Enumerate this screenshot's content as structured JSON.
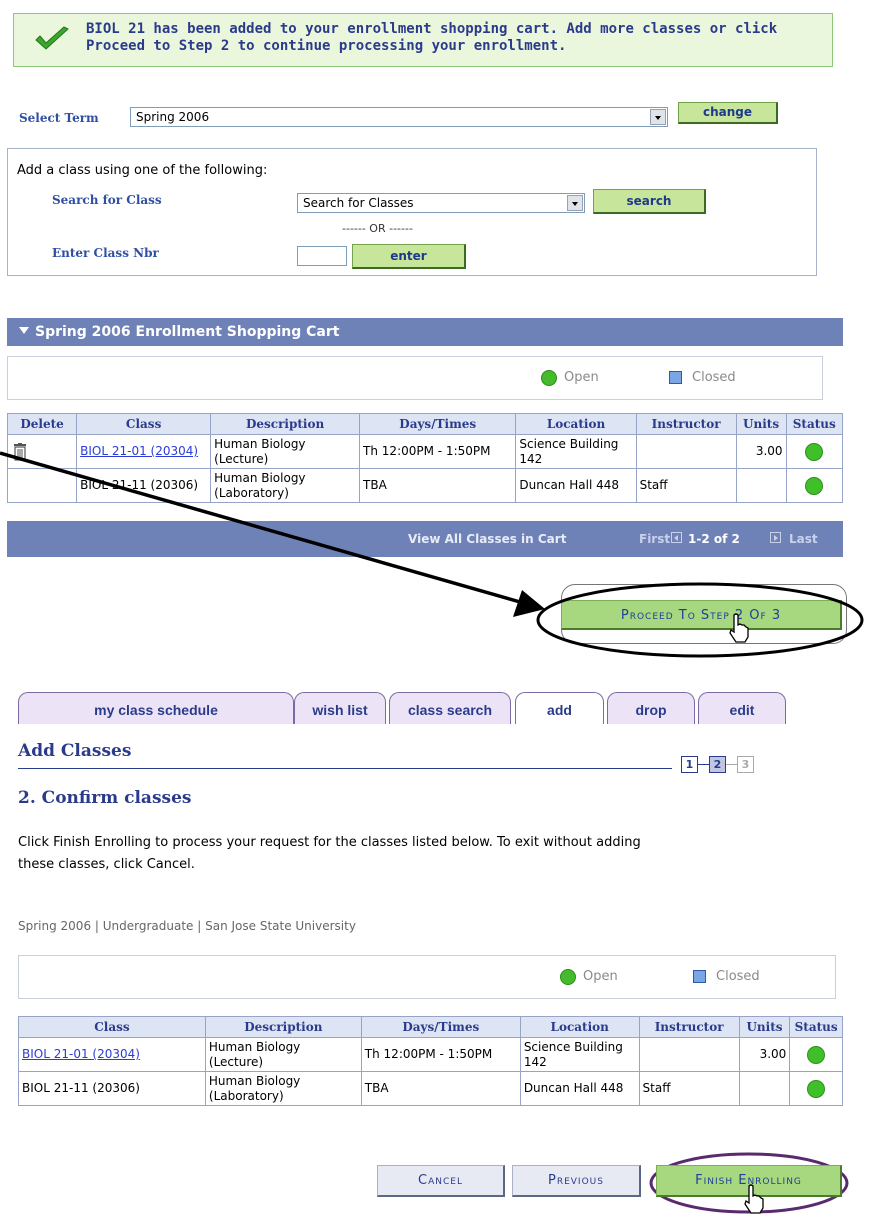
{
  "banner": {
    "text": "BIOL  21 has been added to your enrollment shopping cart. Add more classes or click Proceed to Step 2 to continue processing your enrollment."
  },
  "term": {
    "label": "Select Term",
    "value": "Spring 2006",
    "change_label": "change"
  },
  "add_class": {
    "heading": "Add a class using one of the following:",
    "search_label": "Search for Class",
    "search_value": "Search for Classes",
    "search_button": "search",
    "or_text": "------ OR ------",
    "nbr_label": "Enter Class Nbr",
    "nbr_value": "",
    "enter_button": "enter"
  },
  "cart": {
    "title": "Spring 2006 Enrollment Shopping Cart",
    "legend": {
      "open": "Open",
      "closed": "Closed"
    },
    "columns": [
      "Delete",
      "Class",
      "Description",
      "Days/Times",
      "Location",
      "Instructor",
      "Units",
      "Status"
    ],
    "rows": [
      {
        "class": "BIOL 21-01 (20304)",
        "description": "Human Biology (Lecture)",
        "days_times": "Th 12:00PM - 1:50PM",
        "location": "Science Building 142",
        "instructor": "",
        "units": "3.00"
      },
      {
        "class": "BIOL 21-11 (20306)",
        "description": "Human Biology (Laboratory)",
        "days_times": "TBA",
        "location": "Duncan Hall 448",
        "instructor": "Staff",
        "units": ""
      }
    ],
    "nav": {
      "view_all": "View All Classes in Cart",
      "first": "First",
      "range": "1-2 of 2",
      "last": "Last"
    },
    "proceed_button": "Proceed To Step 2 Of 3"
  },
  "tabs": [
    "my class schedule",
    "wish list",
    "class search",
    "add",
    "drop",
    "edit"
  ],
  "confirm": {
    "page_title": "Add Classes",
    "steps": [
      "1",
      "2",
      "3"
    ],
    "subtitle": "2. Confirm classes",
    "instructions": "Click Finish Enrolling to process your request for the classes listed below. To exit without adding these classes, click Cancel.",
    "context": "Spring 2006 | Undergraduate | San Jose State University",
    "legend": {
      "open": "Open",
      "closed": "Closed"
    },
    "columns": [
      "Class",
      "Description",
      "Days/Times",
      "Location",
      "Instructor",
      "Units",
      "Status"
    ],
    "rows": [
      {
        "class": "BIOL 21-01 (20304)",
        "description": "Human Biology (Lecture)",
        "days_times": "Th 12:00PM - 1:50PM",
        "location": "Science Building 142",
        "instructor": "",
        "units": "3.00"
      },
      {
        "class": "BIOL 21-11 (20306)",
        "description": "Human Biology (Laboratory)",
        "days_times": "TBA",
        "location": "Duncan Hall 448",
        "instructor": "Staff",
        "units": ""
      }
    ],
    "cancel_button": "Cancel",
    "previous_button": "Previous",
    "finish_button": "Finish Enrolling"
  },
  "colors": {
    "header_bar": "#6e82b8",
    "open_green": "#44bb2b",
    "button_green": "#c7e59b",
    "highlight_oval": "#5a2a6e"
  }
}
